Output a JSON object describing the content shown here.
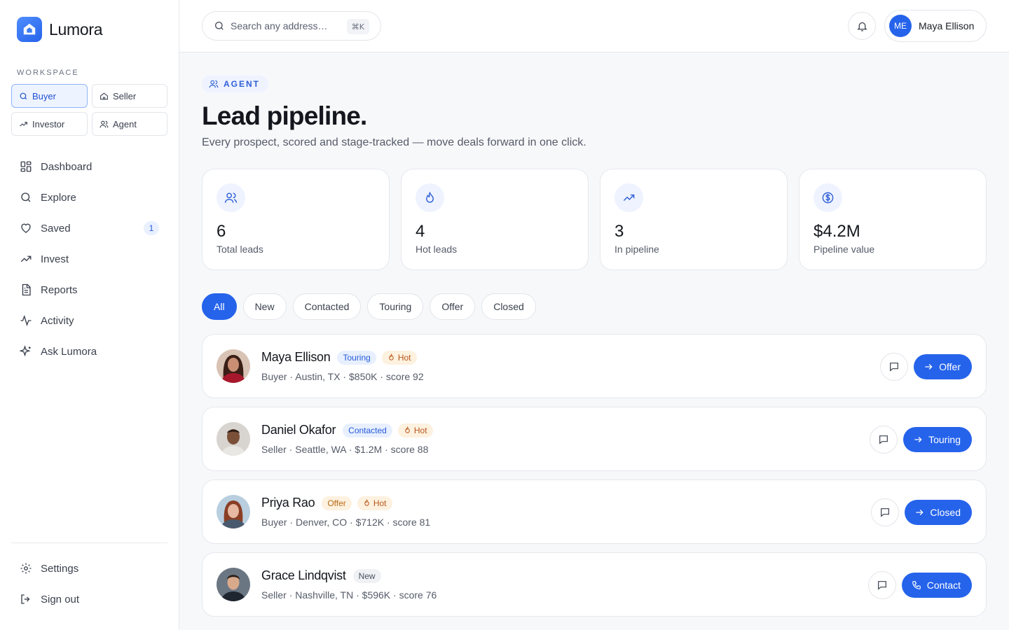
{
  "brand": {
    "name": "Lumora"
  },
  "workspace": {
    "label": "WORKSPACE",
    "options": [
      {
        "label": "Buyer",
        "icon": "search-icon",
        "active": true
      },
      {
        "label": "Seller",
        "icon": "home-icon",
        "active": false
      },
      {
        "label": "Investor",
        "icon": "trending-up-icon",
        "active": false
      },
      {
        "label": "Agent",
        "icon": "users-icon",
        "active": false
      }
    ]
  },
  "nav": {
    "items": [
      {
        "label": "Dashboard",
        "icon": "grid-icon"
      },
      {
        "label": "Explore",
        "icon": "search-icon"
      },
      {
        "label": "Saved",
        "icon": "heart-icon",
        "badge": "1"
      },
      {
        "label": "Invest",
        "icon": "trending-up-icon"
      },
      {
        "label": "Reports",
        "icon": "document-icon"
      },
      {
        "label": "Activity",
        "icon": "activity-icon"
      },
      {
        "label": "Ask Lumora",
        "icon": "sparkle-icon"
      }
    ],
    "bottom": [
      {
        "label": "Settings",
        "icon": "gear-icon"
      },
      {
        "label": "Sign out",
        "icon": "sign-out-icon"
      }
    ]
  },
  "topbar": {
    "search": {
      "placeholder": "Search any address…",
      "shortcut": "⌘K"
    },
    "user": {
      "initials": "ME",
      "name": "Maya Ellison"
    }
  },
  "page": {
    "role": "AGENT",
    "title": "Lead pipeline.",
    "subtitle": "Every prospect, scored and stage-tracked — move deals forward in one click."
  },
  "stats": [
    {
      "value": "6",
      "label": "Total leads",
      "icon": "users-icon"
    },
    {
      "value": "4",
      "label": "Hot leads",
      "icon": "flame-icon"
    },
    {
      "value": "3",
      "label": "In pipeline",
      "icon": "trending-up-icon"
    },
    {
      "value": "$4.2M",
      "label": "Pipeline value",
      "icon": "dollar-icon"
    }
  ],
  "filters": [
    {
      "label": "All",
      "active": true
    },
    {
      "label": "New",
      "active": false
    },
    {
      "label": "Contacted",
      "active": false
    },
    {
      "label": "Touring",
      "active": false
    },
    {
      "label": "Offer",
      "active": false
    },
    {
      "label": "Closed",
      "active": false
    }
  ],
  "leads": [
    {
      "name": "Maya Ellison",
      "stage": "Touring",
      "hot": "Hot",
      "meta": "Buyer · Austin, TX · $850K · score 92",
      "action": "Offer",
      "action_icon": "arrow-right-icon"
    },
    {
      "name": "Daniel Okafor",
      "stage": "Contacted",
      "hot": "Hot",
      "meta": "Seller · Seattle, WA · $1.2M · score 88",
      "action": "Touring",
      "action_icon": "arrow-right-icon"
    },
    {
      "name": "Priya Rao",
      "stage": "Offer",
      "hot": "Hot",
      "meta": "Buyer · Denver, CO · $712K · score 81",
      "action": "Closed",
      "action_icon": "arrow-right-icon"
    },
    {
      "name": "Grace Lindqvist",
      "stage": "New",
      "hot": "",
      "meta": "Seller · Nashville, TN · $596K · score 76",
      "action": "Contact",
      "action_icon": "phone-icon"
    }
  ]
}
